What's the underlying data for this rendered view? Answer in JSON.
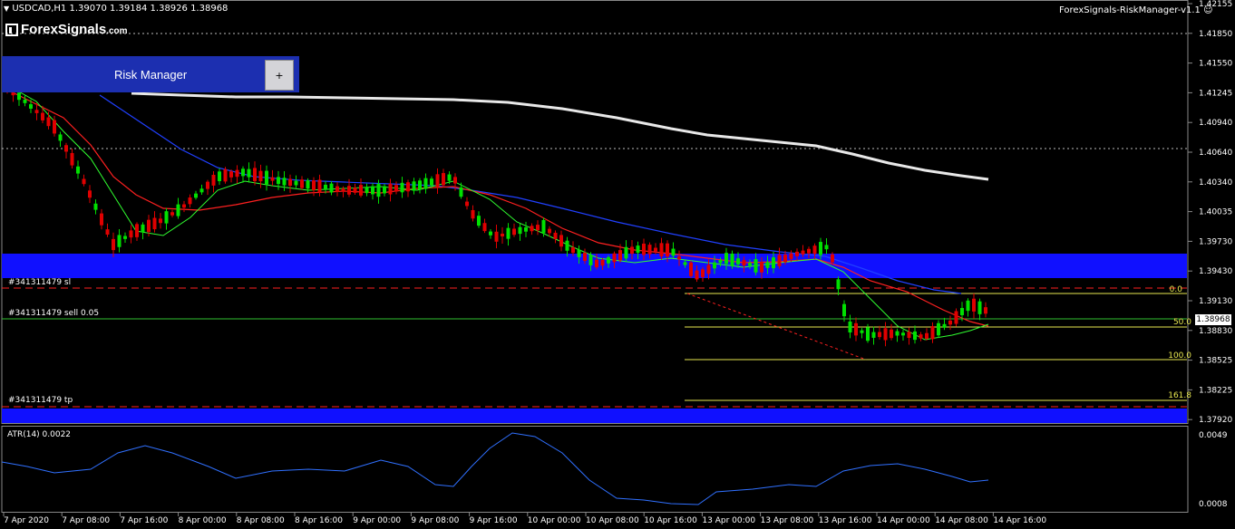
{
  "window": {
    "symbol_line": "USDCAD,H1  1.39070 1.39184 1.38926 1.38968",
    "indicator_tag": "ForexSignals-RiskManager-v1.1",
    "atr_label": "ATR(14) 0.0022"
  },
  "logo": {
    "main": "ForexSignals",
    "domain": ".com"
  },
  "risk_manager": {
    "title": "Risk Manager",
    "button": "+"
  },
  "orders": {
    "sl_label": "#341311479 sl",
    "entry_label": "#341311479 sell 0.05",
    "tp_label": "#341311479 tp"
  },
  "fib_levels": [
    "0.0",
    "50.0",
    "100.0",
    "161.8"
  ],
  "current_price": "1.38968",
  "price_axis": [
    "1.42155",
    "1.41850",
    "1.41550",
    "1.41245",
    "1.40940",
    "1.40640",
    "1.40340",
    "1.40035",
    "1.39730",
    "1.39430",
    "1.39130",
    "1.38830",
    "1.38525",
    "1.38225",
    "1.37920"
  ],
  "atr_axis": [
    "0.0049",
    "0.0008"
  ],
  "time_axis": [
    "7 Apr 2020",
    "7 Apr 08:00",
    "7 Apr 16:00",
    "8 Apr 00:00",
    "8 Apr 08:00",
    "8 Apr 16:00",
    "9 Apr 00:00",
    "9 Apr 08:00",
    "9 Apr 16:00",
    "10 Apr 00:00",
    "10 Apr 08:00",
    "10 Apr 16:00",
    "13 Apr 00:00",
    "13 Apr 08:00",
    "13 Apr 16:00",
    "14 Apr 00:00",
    "14 Apr 08:00",
    "14 Apr 16:00"
  ],
  "colors": {
    "bull": "#00e000",
    "bear": "#e00000",
    "zone": "#1010ff",
    "ma_white": "#e8e8e8",
    "ma_blue": "#2040ff",
    "ma_red": "#ff2020",
    "ma_green": "#30ff30",
    "fib": "#e8e850",
    "atr": "#3070ff",
    "panel": "#1c2fb0"
  }
}
